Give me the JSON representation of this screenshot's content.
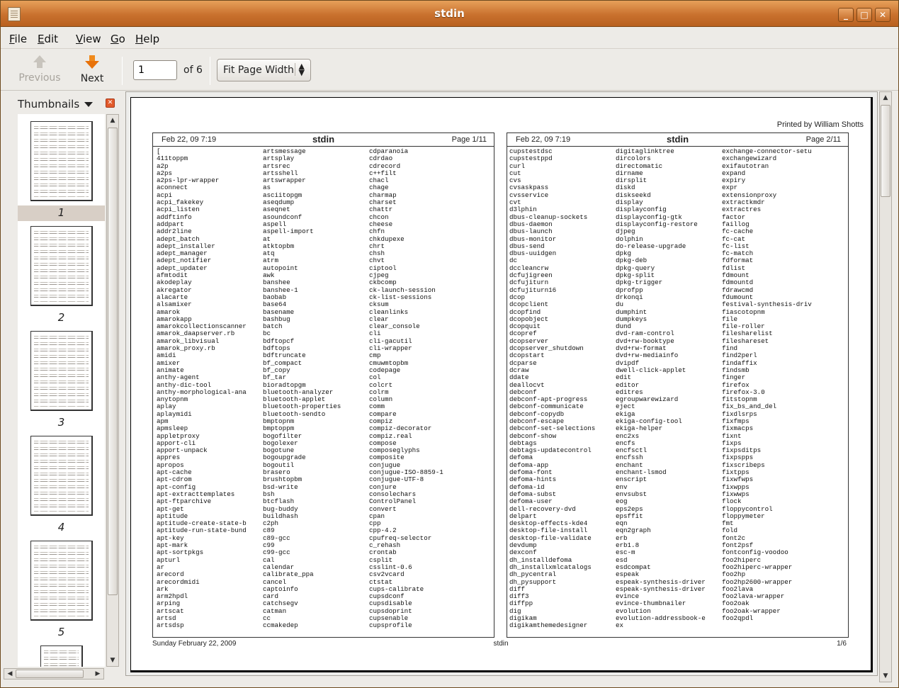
{
  "window": {
    "title": "stdin",
    "minimize_glyph": "_",
    "maximize_glyph": "□",
    "close_glyph": "✕"
  },
  "menu": [
    {
      "key": "F",
      "rest": "ile"
    },
    {
      "key": "E",
      "rest": "dit"
    },
    {
      "key": "V",
      "rest": "iew"
    },
    {
      "key": "G",
      "rest": "o"
    },
    {
      "key": "H",
      "rest": "elp"
    }
  ],
  "toolbar": {
    "previous_label": "Previous",
    "next_label": "Next",
    "page_value": "1",
    "page_of": "of 6",
    "zoom_value": "Fit Page Width"
  },
  "sidebar": {
    "title": "Thumbnails",
    "thumbnails": [
      "1",
      "2",
      "3",
      "4",
      "5"
    ],
    "selected_index": 0
  },
  "document": {
    "printed_by": "Printed by William Shotts",
    "footer_date": "Sunday February 22, 2009",
    "footer_title": "stdin",
    "footer_page": "1/6",
    "pages": [
      {
        "date": "Feb 22, 09 7:19",
        "title": "stdin",
        "page": "Page 1/11",
        "columns": [
          [
            "[",
            "411toppm",
            "a2p",
            "a2ps",
            "a2ps-lpr-wrapper",
            "aconnect",
            "acpi",
            "acpi_fakekey",
            "acpi_listen",
            "addftinfo",
            "addpart",
            "addr2line",
            "adept_batch",
            "adept_installer",
            "adept_manager",
            "adept_notifier",
            "adept_updater",
            "afmtodit",
            "akodeplay",
            "akregator",
            "alacarte",
            "alsamixer",
            "amarok",
            "amarokapp",
            "amarokcollectionscanner",
            "amarok_daapserver.rb",
            "amarok_libvisual",
            "amarok_proxy.rb",
            "amidi",
            "amixer",
            "animate",
            "anthy-agent",
            "anthy-dic-tool",
            "anthy-morphological-ana",
            "anytopnm",
            "aplay",
            "aplaymidi",
            "apm",
            "apmsleep",
            "appletproxy",
            "apport-cli",
            "apport-unpack",
            "appres",
            "apropos",
            "apt-cache",
            "apt-cdrom",
            "apt-config",
            "apt-extracttemplates",
            "apt-ftparchive",
            "apt-get",
            "aptitude",
            "aptitude-create-state-b",
            "aptitude-run-state-bund",
            "apt-key",
            "apt-mark",
            "apt-sortpkgs",
            "apturl",
            "ar",
            "arecord",
            "arecordmidi",
            "ark",
            "arm2hpdl",
            "arping",
            "artscat",
            "artsd",
            "artsdsp"
          ],
          [
            "artsmessage",
            "artsplay",
            "artsrec",
            "artsshell",
            "artswrapper",
            "as",
            "asciitopgm",
            "aseqdump",
            "aseqnet",
            "asoundconf",
            "aspell",
            "aspell-import",
            "at",
            "atktopbm",
            "atq",
            "atrm",
            "autopoint",
            "awk",
            "banshee",
            "banshee-1",
            "baobab",
            "base64",
            "basename",
            "bashbug",
            "batch",
            "bc",
            "bdftopcf",
            "bdftops",
            "bdftruncate",
            "bf_compact",
            "bf_copy",
            "bf_tar",
            "bioradtopgm",
            "bluetooth-analyzer",
            "bluetooth-applet",
            "bluetooth-properties",
            "bluetooth-sendto",
            "bmptopnm",
            "bmptoppm",
            "bogofilter",
            "bogolexer",
            "bogotune",
            "bogoupgrade",
            "bogoutil",
            "brasero",
            "brushtopbm",
            "bsd-write",
            "bsh",
            "btcflash",
            "bug-buddy",
            "buildhash",
            "c2ph",
            "c89",
            "c89-gcc",
            "c99",
            "c99-gcc",
            "cal",
            "calendar",
            "calibrate_ppa",
            "cancel",
            "captoinfo",
            "card",
            "catchsegv",
            "catman",
            "cc",
            "ccmakedep"
          ],
          [
            "cdparanoia",
            "cdrdao",
            "cdrecord",
            "c++filt",
            "chacl",
            "chage",
            "charmap",
            "charset",
            "chattr",
            "chcon",
            "cheese",
            "chfn",
            "chkdupexe",
            "chrt",
            "chsh",
            "chvt",
            "ciptool",
            "cjpeg",
            "ckbcomp",
            "ck-launch-session",
            "ck-list-sessions",
            "cksum",
            "cleanlinks",
            "clear",
            "clear_console",
            "cli",
            "cli-gacutil",
            "cli-wrapper",
            "cmp",
            "cmuwmtopbm",
            "codepage",
            "col",
            "colcrt",
            "colrm",
            "column",
            "comm",
            "compare",
            "compiz",
            "compiz-decorator",
            "compiz.real",
            "compose",
            "composeglyphs",
            "composite",
            "conjugue",
            "conjugue-ISO-8859-1",
            "conjugue-UTF-8",
            "conjure",
            "consolechars",
            "ControlPanel",
            "convert",
            "cpan",
            "cpp",
            "cpp-4.2",
            "cpufreq-selector",
            "c_rehash",
            "crontab",
            "csplit",
            "csslint-0.6",
            "csv2vcard",
            "ctstat",
            "cups-calibrate",
            "cupsdconf",
            "cupsdisable",
            "cupsdoprint",
            "cupsenable",
            "cupsprofile"
          ]
        ]
      },
      {
        "date": "Feb 22, 09 7:19",
        "title": "stdin",
        "page": "Page 2/11",
        "columns": [
          [
            "cupstestdsc",
            "cupstestppd",
            "curl",
            "cut",
            "cvs",
            "cvsaskpass",
            "cvsservice",
            "cvt",
            "d3lphin",
            "dbus-cleanup-sockets",
            "dbus-daemon",
            "dbus-launch",
            "dbus-monitor",
            "dbus-send",
            "dbus-uuidgen",
            "dc",
            "dccleancrw",
            "dcfujigreen",
            "dcfujiturn",
            "dcfujiturn16",
            "dcop",
            "dcopclient",
            "dcopfind",
            "dcopobject",
            "dcopquit",
            "dcopref",
            "dcopserver",
            "dcopserver_shutdown",
            "dcopstart",
            "dcparse",
            "dcraw",
            "ddate",
            "deallocvt",
            "debconf",
            "debconf-apt-progress",
            "debconf-communicate",
            "debconf-copydb",
            "debconf-escape",
            "debconf-set-selections",
            "debconf-show",
            "debtags",
            "debtags-updatecontrol",
            "defoma",
            "defoma-app",
            "defoma-font",
            "defoma-hints",
            "defoma-id",
            "defoma-subst",
            "defoma-user",
            "dell-recovery-dvd",
            "delpart",
            "desktop-effects-kde4",
            "desktop-file-install",
            "desktop-file-validate",
            "devdump",
            "dexconf",
            "dh_installdefoma",
            "dh_installxmlcatalogs",
            "dh_pycentral",
            "dh_pysupport",
            "diff",
            "diff3",
            "diffpp",
            "dig",
            "digikam",
            "digikamthemedesigner"
          ],
          [
            "digitaglinktree",
            "dircolors",
            "directomatic",
            "dirname",
            "dirsplit",
            "diskd",
            "diskseekd",
            "display",
            "displayconfig",
            "displayconfig-gtk",
            "displayconfig-restore",
            "djpeg",
            "dolphin",
            "do-release-upgrade",
            "dpkg",
            "dpkg-deb",
            "dpkg-query",
            "dpkg-split",
            "dpkg-trigger",
            "dprofpp",
            "drkonqi",
            "du",
            "dumphint",
            "dumpkeys",
            "dund",
            "dvd-ram-control",
            "dvd+rw-booktype",
            "dvd+rw-format",
            "dvd+rw-mediainfo",
            "dvipdf",
            "dwell-click-applet",
            "edit",
            "editor",
            "editres",
            "egroupwarewizard",
            "eject",
            "ekiga",
            "ekiga-config-tool",
            "ekiga-helper",
            "enc2xs",
            "encfs",
            "encfsctl",
            "encfssh",
            "enchant",
            "enchant-lsmod",
            "enscript",
            "env",
            "envsubst",
            "eog",
            "eps2eps",
            "epsffit",
            "eqn",
            "eqn2graph",
            "erb",
            "erb1.8",
            "esc-m",
            "esd",
            "esdcompat",
            "espeak",
            "espeak-synthesis-driver",
            "espeak-synthesis-driver",
            "evince",
            "evince-thumbnailer",
            "evolution",
            "evolution-addressbook-e",
            "ex"
          ],
          [
            "exchange-connector-setu",
            "exchangewizard",
            "exifautotran",
            "expand",
            "expiry",
            "expr",
            "extensionproxy",
            "extractkmdr",
            "extractres",
            "factor",
            "faillog",
            "fc-cache",
            "fc-cat",
            "fc-list",
            "fc-match",
            "fdformat",
            "fdlist",
            "fdmount",
            "fdmountd",
            "fdrawcmd",
            "fdumount",
            "festival-synthesis-driv",
            "fiascotopnm",
            "file",
            "file-roller",
            "filesharelist",
            "fileshareset",
            "find",
            "find2perl",
            "findaffix",
            "findsmb",
            "finger",
            "firefox",
            "firefox-3.0",
            "fitstopnm",
            "fix_bs_and_del",
            "fixdlsrps",
            "fixfmps",
            "fixmacps",
            "fixnt",
            "fixps",
            "fixpsditps",
            "fixpspps",
            "fixscribeps",
            "fixtpps",
            "fixwfwps",
            "fixwpps",
            "fixwwps",
            "flock",
            "floppycontrol",
            "floppymeter",
            "fmt",
            "fold",
            "font2c",
            "font2psf",
            "fontconfig-voodoo",
            "foo2hiperc",
            "foo2hiperc-wrapper",
            "foo2hp",
            "foo2hp2600-wrapper",
            "foo2lava",
            "foo2lava-wrapper",
            "foo2oak",
            "foo2oak-wrapper",
            "foo2qpdl"
          ]
        ]
      }
    ]
  }
}
